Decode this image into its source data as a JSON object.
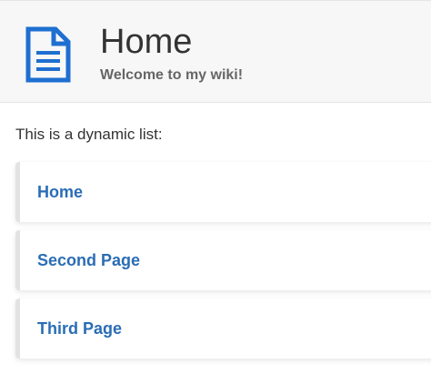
{
  "header": {
    "title": "Home",
    "subtitle": "Welcome to my wiki!",
    "icon": "document-icon",
    "icon_color": "#1e6fd0"
  },
  "content": {
    "intro": "This is a dynamic list:"
  },
  "list": {
    "items": [
      {
        "label": "Home"
      },
      {
        "label": "Second Page"
      },
      {
        "label": "Third Page"
      }
    ],
    "link_color": "#2a6db5"
  }
}
